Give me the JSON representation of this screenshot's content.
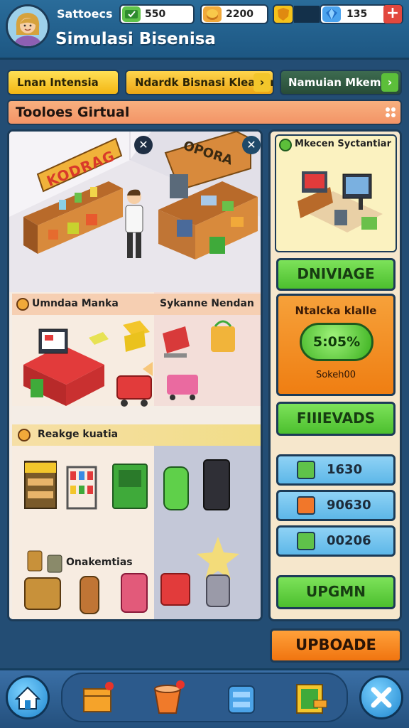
{
  "header": {
    "subtitle": "Sattoecs",
    "title": "Simulasi Bisenisa",
    "resources": [
      {
        "icon": "cash-icon",
        "value": "550"
      },
      {
        "icon": "coins-icon",
        "value": "2200"
      },
      {
        "icon": "gem-icon",
        "value": "135"
      }
    ]
  },
  "nav_tabs": [
    {
      "label": "Lnan Intensia"
    },
    {
      "label": "Ndardk Bisnasi Kleadan"
    },
    {
      "label": "Namuian Mkeman"
    }
  ],
  "section": {
    "title": "Tooloes Girtual"
  },
  "scene": {
    "sign_left": "KODRAG",
    "sign_right": "OPORA"
  },
  "categories": [
    {
      "label": "Umndaa Manka"
    },
    {
      "label": "Sykanne Nendan"
    },
    {
      "label": "Reakge kuatia"
    },
    {
      "label": "Onakemtias"
    }
  ],
  "side": {
    "preview_title": "Mkecen Syctantiar",
    "btn1": "DNIVIAGE",
    "offer_title": "Ntalcka klalle",
    "offer_value": "5:05%",
    "offer_caption": "Sokeh00",
    "btn2": "FIIIEVADS",
    "stats": [
      {
        "icon": "cash-stat-icon",
        "value": "1630"
      },
      {
        "icon": "box-stat-icon",
        "value": "90630"
      },
      {
        "icon": "ledger-stat-icon",
        "value": "00206"
      }
    ],
    "btn3": "UPGMN"
  },
  "update_button": "UPBOADE",
  "colors": {
    "yellow_tab": "#f5c21a",
    "green_btn": "#5ccd3a",
    "orange_panel": "#f28a1d",
    "stat_blue": "#6cc0ee",
    "header_blue": "#236595"
  }
}
